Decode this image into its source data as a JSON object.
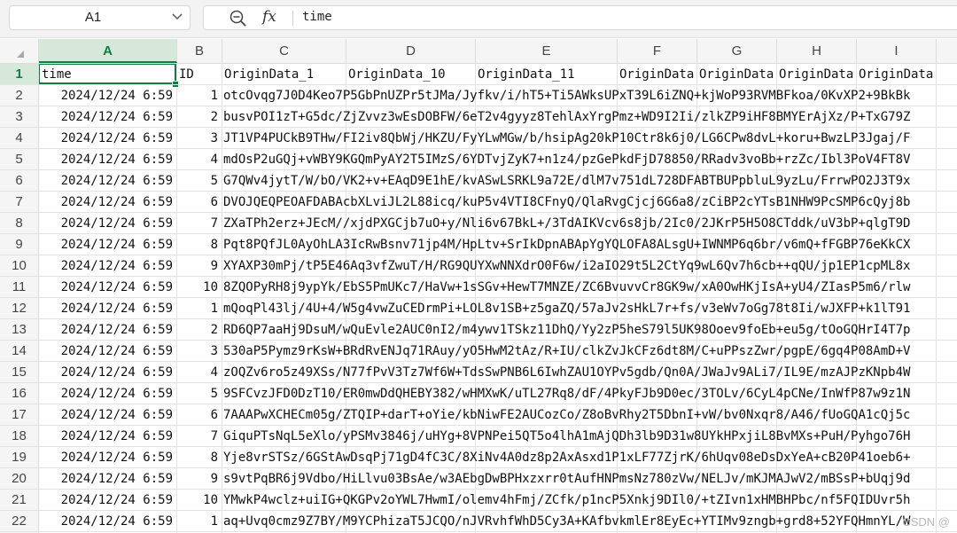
{
  "formula_bar": {
    "name_box": "A1",
    "fx_label": "fx",
    "formula_value": "time"
  },
  "columns": [
    "A",
    "B",
    "C",
    "D",
    "E",
    "F",
    "G",
    "H",
    "I"
  ],
  "header_row": {
    "time": "time",
    "id": "ID",
    "origin": [
      "OriginData_1",
      "OriginData_10",
      "OriginData_11",
      "OriginData",
      "OriginData",
      "OriginData",
      "OriginData"
    ]
  },
  "rows": [
    {
      "num": "2",
      "time": "2024/12/24 6:59",
      "id": "1",
      "data": "otcOvqg7J0D4Keo7P5GbPnUZPr5tJMa/Jyfkv/i/hT5+Ti5AWksUPxT39L6iZNQ+kjWoP93RVMBFkoa/0KvXP2+9BkBk"
    },
    {
      "num": "3",
      "time": "2024/12/24 6:59",
      "id": "2",
      "data": "busvPOI1zT+G5dc/ZjZvvz3wEsDOBFW/6eT2v4gyyz8TehlAxYrgPmz+WD9I2Ii/zlkZP9iHF8BMYErAjXz/P+TxG79Z"
    },
    {
      "num": "4",
      "time": "2024/12/24 6:59",
      "id": "3",
      "data": "JT1VP4PUCkB9THw/FI2iv8QbWj/HKZU/FyYLwMGw/b/hsipAg20kP10Ctr8k6j0/LG6CPw8dvL+koru+BwzLP3Jgaj/F"
    },
    {
      "num": "5",
      "time": "2024/12/24 6:59",
      "id": "4",
      "data": "mdOsP2uGQj+vWBY9KGQmPyAY2T5IMzS/6YDTvjZyK7+n1z4/pzGePkdFjD78850/RRadv3voBb+rzZc/Ibl3PoV4FT8V"
    },
    {
      "num": "6",
      "time": "2024/12/24 6:59",
      "id": "5",
      "data": "G7QWv4jytT/W/bO/VK2+v+EAqD9E1hE/kvASwLSRKL9a72E/dlM7v751dL728DFABTBUPpbluL9yzLu/FrrwPO2J3T9x"
    },
    {
      "num": "7",
      "time": "2024/12/24 6:59",
      "id": "6",
      "data": "DVOJQEQPEOAFDABAcbXLviJL2L88icq/kuP5v4VTI8CFnyQ/QlaRvgCjcj6G6a8/zCiBP2cYTsB1NHW9PcSMP6cQyj8b"
    },
    {
      "num": "8",
      "time": "2024/12/24 6:59",
      "id": "7",
      "data": "ZXaTPh2erz+JEcM//xjdPXGCjb7uO+y/Nli6v67BkL+/3TdAIKVcv6s8jb/2Ic0/2JKrP5H5O8CTddk/uV3bP+qlgT9D"
    },
    {
      "num": "9",
      "time": "2024/12/24 6:59",
      "id": "8",
      "data": "Pqt8PQfJL0AyOhLA3IcRwBsnv71jp4M/HpLtv+SrIkDpnABApYgYQLOFA8ALsgU+IWNMP6q6br/v6mQ+fFGBP76eKkCX"
    },
    {
      "num": "10",
      "time": "2024/12/24 6:59",
      "id": "9",
      "data": "XYAXP30mPj/tP5E46Aq3vfZwuT/H/RG9QUYXwNNXdrO0F6w/i2aIO29t5L2CtYq9wL6Qv7h6cb++qQU/jp1EP1cpML8x"
    },
    {
      "num": "11",
      "time": "2024/12/24 6:59",
      "id": "10",
      "data": "8ZQOPyRH8j9ypYk/EbS5PmUKc7/HaVw+1sSGv+HewT7MNZE/ZC6BvuvvCr8GK9w/xA0OwHKjIsA+yU4/ZIasP5m6/rlw"
    },
    {
      "num": "12",
      "time": "2024/12/24 6:59",
      "id": "1",
      "data": "mQoqPl43lj/4U+4/W5g4vwZuCEDrmPi+LOL8v1SB+z5gaZQ/57aJv2sHkL7r+fs/v3eWv7oGg78t8Ii/wJXFP+k1lT91"
    },
    {
      "num": "13",
      "time": "2024/12/24 6:59",
      "id": "2",
      "data": "RD6QP7aaHj9DsuM/wQuEvle2AUC0nI2/m4ywv1TSkz11DhQ/Yy2zP5heS79l5UK98Ooev9foEb+eu5g/tOoGQHrI4T7p"
    },
    {
      "num": "14",
      "time": "2024/12/24 6:59",
      "id": "3",
      "data": "530aP5Pymz9rKsW+BRdRvENJq71RAuy/yO5HwM2tAz/R+IU/clkZvJkCFz6dt8M/C+uPPszZwr/pgpE/6gq4P08AmD+V"
    },
    {
      "num": "15",
      "time": "2024/12/24 6:59",
      "id": "4",
      "data": "zOQZv6ro5z49XSs/N77fPvV3Tz7Wf6W+TdsSwPNB6L6IwhZAU1OYPv5gdb/Qn0A/JWaJv9ALi7/IL9E/mzAJPzKNpb4W"
    },
    {
      "num": "16",
      "time": "2024/12/24 6:59",
      "id": "5",
      "data": "9SFCvzJFD0DzT10/ER0mwDdQHEBY382/wHMXwK/uTL27Rq8/dF/4PkyFJb9D0ec/3TOLv/6CyL4pCNe/InWfP87w9z1N"
    },
    {
      "num": "17",
      "time": "2024/12/24 6:59",
      "id": "6",
      "data": "7AAAPwXCHECm05g/ZTQIP+darT+oYie/kbNiwFE2AUCozCo/Z8oBvRhy2T5DbnI+vW/bv0Nxqr8/A46/fUoGQA1cQj5c"
    },
    {
      "num": "18",
      "time": "2024/12/24 6:59",
      "id": "7",
      "data": "GiquPTsNqL5eXlo/yPSMv3846j/uHYg+8VPNPei5QT5o4lhA1mAjQDh3lb9D31w8UYkHPxjiL8BvMXs+PuH/Pyhgo76H"
    },
    {
      "num": "19",
      "time": "2024/12/24 6:59",
      "id": "8",
      "data": "Yje8vrSTSz/6GStAwDsqPj71gD4fC3C/8XiNv4A0dz8p2AxAsxd1P1xLF77ZjrK/6hUqv08eDsDxYeA+cB20P41oeb6+"
    },
    {
      "num": "20",
      "time": "2024/12/24 6:59",
      "id": "9",
      "data": "s9vtPqBR6j9Vdbo/HiLlvu03BsAe/w3AEbgDwBPHxzxrr0tAufHNPmsNz780zVw/NELJv/mKJMAJwV2/mBSsP+bUqj9d"
    },
    {
      "num": "21",
      "time": "2024/12/24 6:59",
      "id": "10",
      "data": "YMwkP4wclz+uiIG+QKGPv2oYWL7HwmI/olemv4hFmj/ZCfk/p1ncP5Xnkj9DIl0/+tZIvn1xHMBHPbc/nf5FQIDUvr5h"
    },
    {
      "num": "22",
      "time": "2024/12/24 6:59",
      "id": "1",
      "data": "aq+Uvq0cmz9Z7BY/M9YCPhizaT5JCQO/nJVRvhfWhD5Cy3A+KAfbvkmlEr8EyEc+YTIMv9zngb+grd8+52YFQHmnYL/W"
    }
  ],
  "watermark": "CSDN @"
}
